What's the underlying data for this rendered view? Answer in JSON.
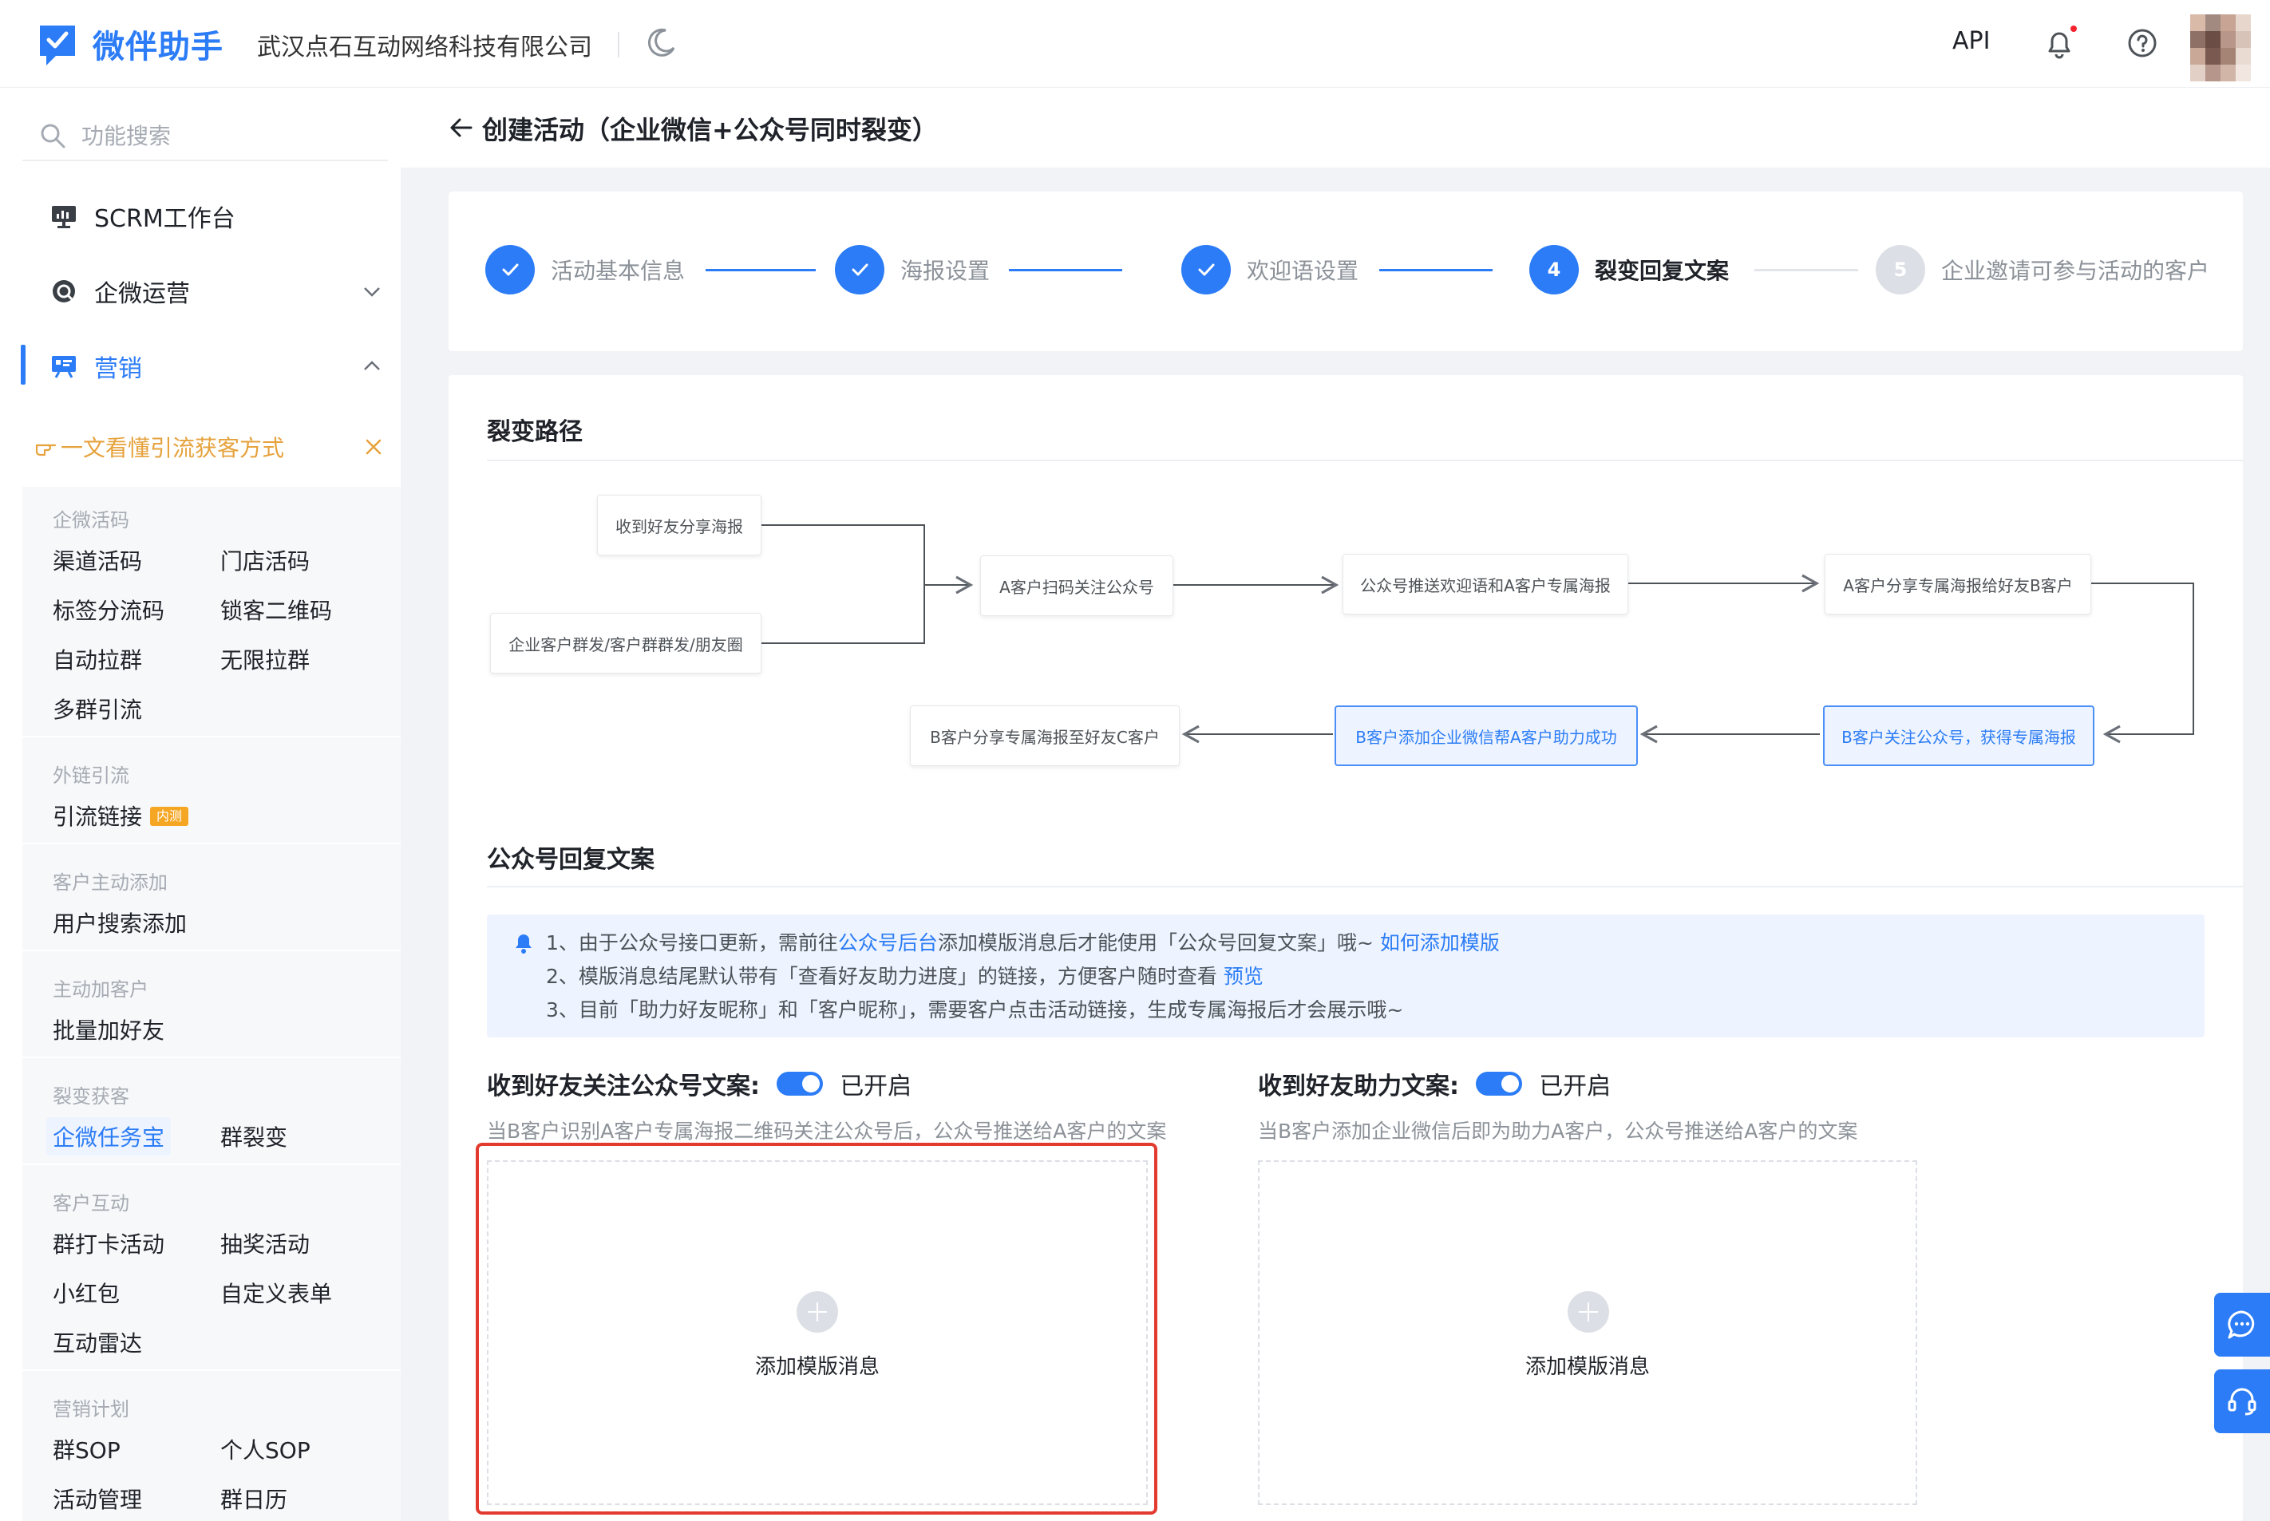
{
  "header": {
    "logo_text": "微伴助手",
    "company": "武汉点石互动网络科技有限公司",
    "api_label": "API",
    "brand_color": "#2b7cf6"
  },
  "sidebar": {
    "search_placeholder": "功能搜索",
    "items": [
      {
        "label": "SCRM工作台",
        "icon": "monitor-chart-icon"
      },
      {
        "label": "企微运营",
        "icon": "chat-bubble-icon"
      },
      {
        "label": "营销",
        "icon": "presentation-icon"
      }
    ],
    "promo": "一文看懂引流获客方式",
    "groups": [
      {
        "title": "企微活码",
        "items": [
          "渠道活码",
          "门店活码",
          "标签分流码",
          "锁客二维码",
          "自动拉群",
          "无限拉群",
          "多群引流"
        ]
      },
      {
        "title": "外链引流",
        "items": [
          "引流链接"
        ],
        "badge": "内测"
      },
      {
        "title": "客户主动添加",
        "items": [
          "用户搜索添加"
        ]
      },
      {
        "title": "主动加客户",
        "items": [
          "批量加好友"
        ]
      },
      {
        "title": "裂变获客",
        "items": [
          "企微任务宝",
          "群裂变"
        ]
      },
      {
        "title": "客户互动",
        "items": [
          "群打卡活动",
          "抽奖活动",
          "小红包",
          "自定义表单",
          "互动雷达"
        ]
      },
      {
        "title": "营销计划",
        "items": [
          "群SOP",
          "个人SOP",
          "活动管理",
          "群日历"
        ]
      }
    ]
  },
  "page": {
    "title": "创建活动（企业微信+公众号同时裂变）"
  },
  "steps": [
    {
      "num": "",
      "label": "活动基本信息",
      "state": "done"
    },
    {
      "num": "",
      "label": "海报设置",
      "state": "done"
    },
    {
      "num": "",
      "label": "欢迎语设置",
      "state": "done"
    },
    {
      "num": "4",
      "label": "裂变回复文案",
      "state": "current"
    },
    {
      "num": "5",
      "label": "企业邀请可参与活动的客户",
      "state": "todo"
    }
  ],
  "flow": {
    "section_title": "裂变路径",
    "nodes": [
      "收到好友分享海报",
      "企业客户群发/客户群群发/朋友圈",
      "A客户扫码关注公众号",
      "公众号推送欢迎语和A客户专属海报",
      "A客户分享专属海报给好友B客户",
      "B客户关注公众号，获得专属海报",
      "B客户添加企业微信帮A客户助力成功",
      "B客户分享专属海报至好友C客户"
    ]
  },
  "reply": {
    "section_title": "公众号回复文案",
    "notice": {
      "line1_pre": "1、由于公众号接口更新，需前往",
      "line1_link1": "公众号后台",
      "line1_mid": "添加模版消息后才能使用「公众号回复文案」哦~ ",
      "line1_link2": "如何添加模版",
      "line2_pre": "2、模版消息结尾默认带有「查看好友助力进度」的链接，方便客户随时查看 ",
      "line2_link": "预览",
      "line3": "3、目前「助力好友昵称」和「客户昵称」，需要客户点击活动链接，生成专属海报后才会展示哦~"
    },
    "left": {
      "title": "收到好友关注公众号文案:",
      "toggle_label": "已开启",
      "desc": "当B客户识别A客户专属海报二维码关注公众号后，公众号推送给A客户的文案",
      "add_label": "添加模版消息"
    },
    "right": {
      "title": "收到好友助力文案:",
      "toggle_label": "已开启",
      "desc": "当B客户添加企业微信后即为助力A客户，公众号推送给A客户的文案",
      "add_label": "添加模版消息"
    }
  }
}
